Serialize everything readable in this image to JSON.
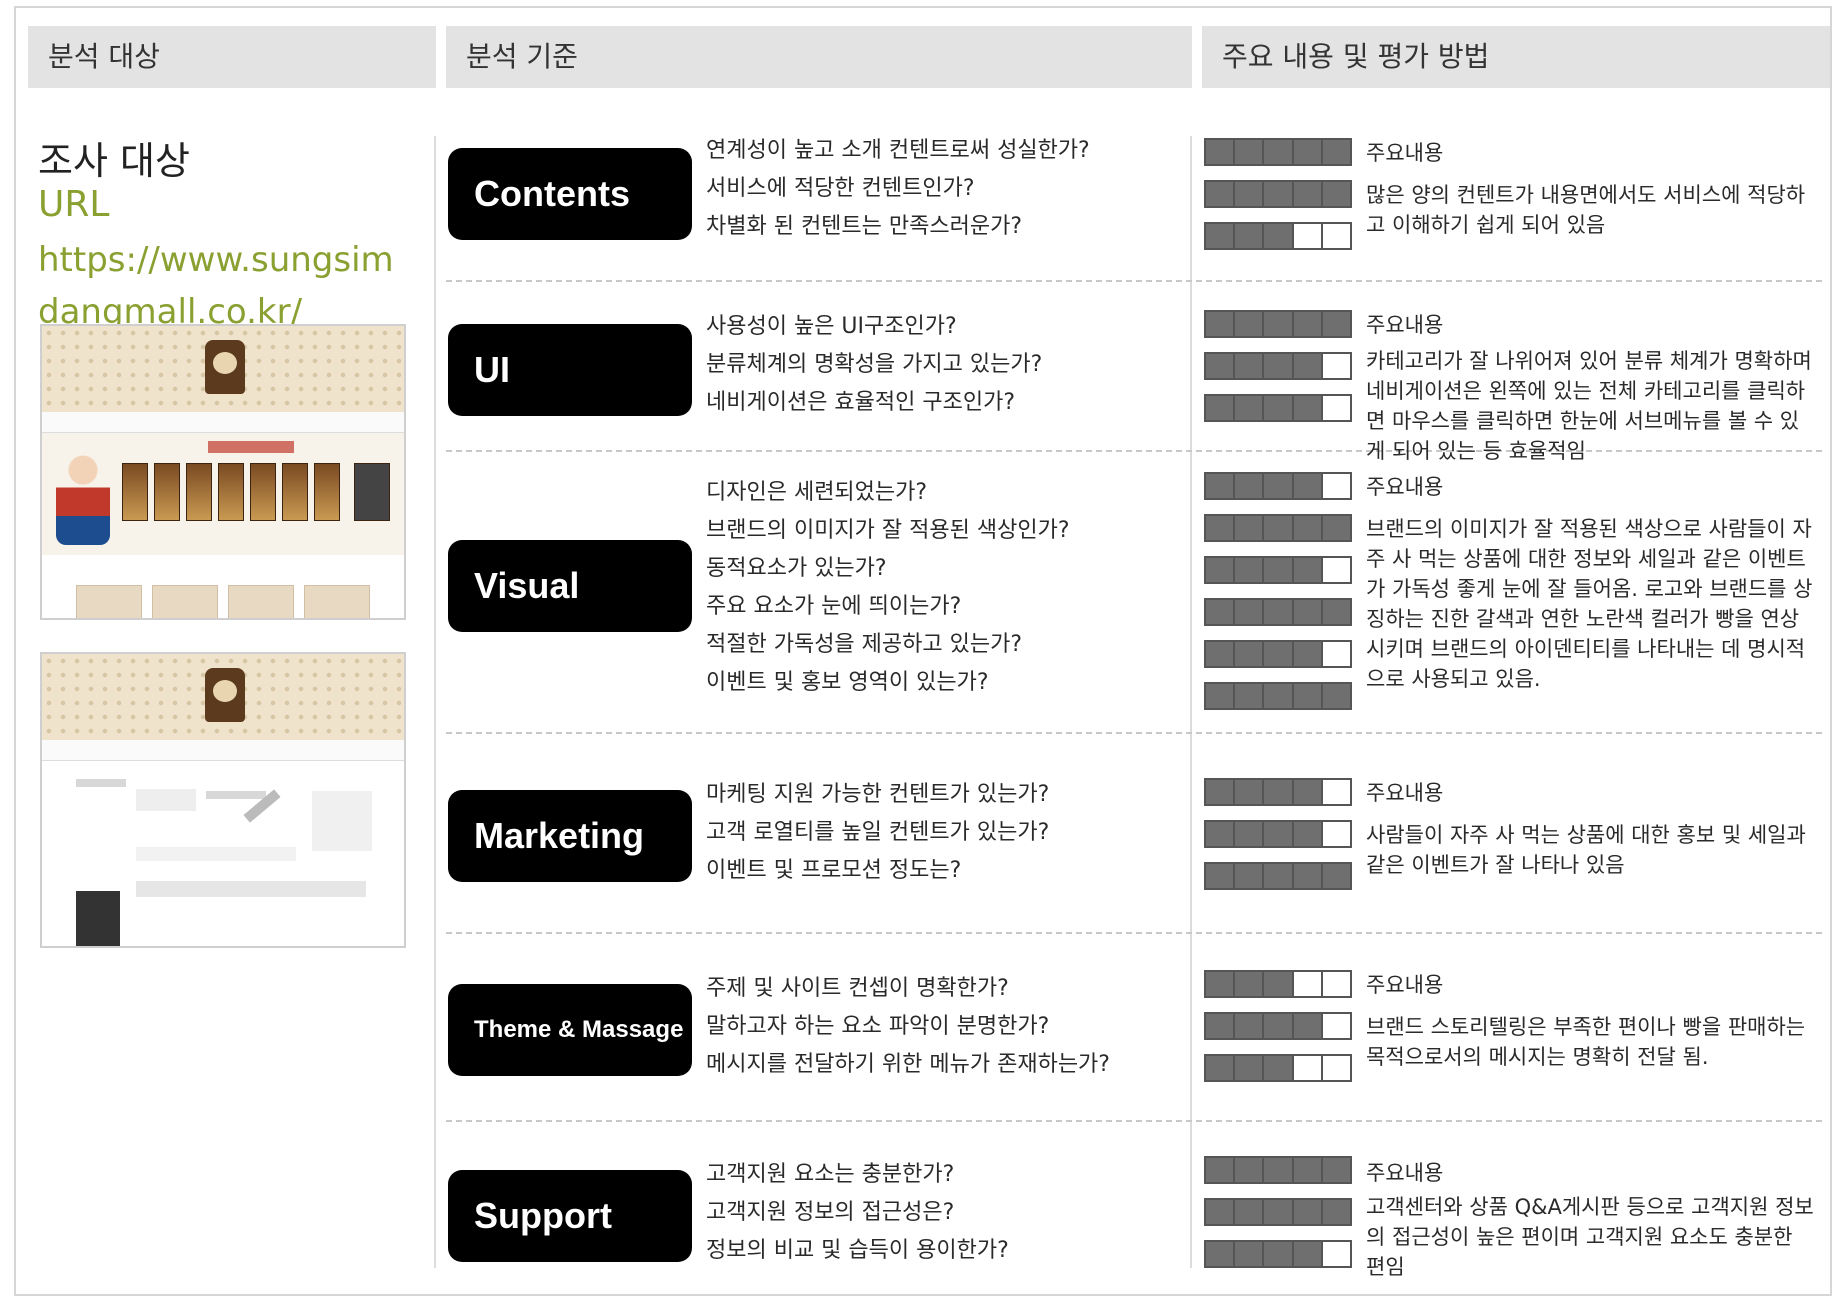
{
  "headers": {
    "target": "분석 대상",
    "criteria": "분석 기준",
    "content": "주요 내용 및 평가 방법"
  },
  "subject": {
    "title": "조사 대상",
    "url_label": "URL",
    "url": "https://www.sungsimdangmall.co.kr/"
  },
  "sections": [
    {
      "label": "Contents",
      "questions": [
        "연계성이 높고 소개 컨텐트로써 성실한가?",
        "서비스에 적당한 컨텐트인가?",
        "차별화 된 컨텐트는 만족스러운가?"
      ],
      "ratings": [
        5,
        5,
        3
      ],
      "heading": "주요내용",
      "text": "많은 양의 컨텐트가 내용면에서도 서비스에 적당하고 이해하기 쉽게 되어 있음"
    },
    {
      "label": "UI",
      "questions": [
        "사용성이 높은 UI구조인가?",
        "분류체계의 명확성을 가지고 있는가?",
        "네비게이션은 효율적인 구조인가?"
      ],
      "ratings": [
        5,
        4,
        4
      ],
      "heading": "주요내용",
      "text": "카테고리가 잘 나위어져 있어 분류 체계가 명확하며 네비게이션은 왼쪽에 있는 전체 카테고리를 클릭하면 마우스를 클릭하면 한눈에 서브메뉴를 볼 수 있게 되어 있는 등 효율적임"
    },
    {
      "label": "Visual",
      "questions": [
        "디자인은 세련되었는가?",
        "브랜드의 이미지가 잘 적용된 색상인가?",
        "동적요소가 있는가?",
        "주요 요소가 눈에 띄이는가?",
        "적절한 가독성을 제공하고 있는가?",
        "이벤트 및 홍보 영역이 있는가?"
      ],
      "ratings": [
        4,
        5,
        4,
        5,
        4,
        5
      ],
      "heading": "주요내용",
      "text": "브랜드의 이미지가 잘 적용된 색상으로 사람들이 자주 사 먹는 상품에 대한 정보와 세일과 같은 이벤트가 가독성 좋게 눈에 잘 들어옴. 로고와 브랜드를 상징하는 진한 갈색과 연한 노란색 컬러가 빵을 연상시키며 브랜드의 아이덴티티를 나타내는 데 명시적으로 사용되고 있음."
    },
    {
      "label": "Marketing",
      "questions": [
        "마케팅 지원 가능한 컨텐트가 있는가?",
        "고객 로열티를 높일 컨텐트가 있는가?",
        "이벤트 및 프로모션 정도는?"
      ],
      "ratings": [
        4,
        4,
        5
      ],
      "heading": "주요내용",
      "text": "사람들이 자주 사 먹는 상품에 대한 홍보 및 세일과 같은 이벤트가 잘 나타나 있음"
    },
    {
      "label": "Theme & Massage",
      "questions": [
        "주제 및 사이트 컨셉이 명확한가?",
        "말하고자 하는 요소 파악이 분명한가?",
        "메시지를 전달하기 위한 메뉴가 존재하는가?"
      ],
      "ratings": [
        3,
        4,
        3
      ],
      "heading": "주요내용",
      "text": "브랜드 스토리텔링은 부족한 편이나 빵을 판매하는 목적으로서의 메시지는 명확히 전달 됨."
    },
    {
      "label": "Support",
      "questions": [
        "고객지원 요소는 충분한가?",
        "고객지원 정보의 접근성은?",
        "정보의 비교 및 습득이 용이한가?"
      ],
      "ratings": [
        5,
        5,
        4
      ],
      "heading": "주요내용",
      "text": "고객센터와 상품 Q&A게시판 등으로 고객지원 정보의 접근성이 높은 편이며 고객지원 요소도 충분한 편임"
    }
  ]
}
